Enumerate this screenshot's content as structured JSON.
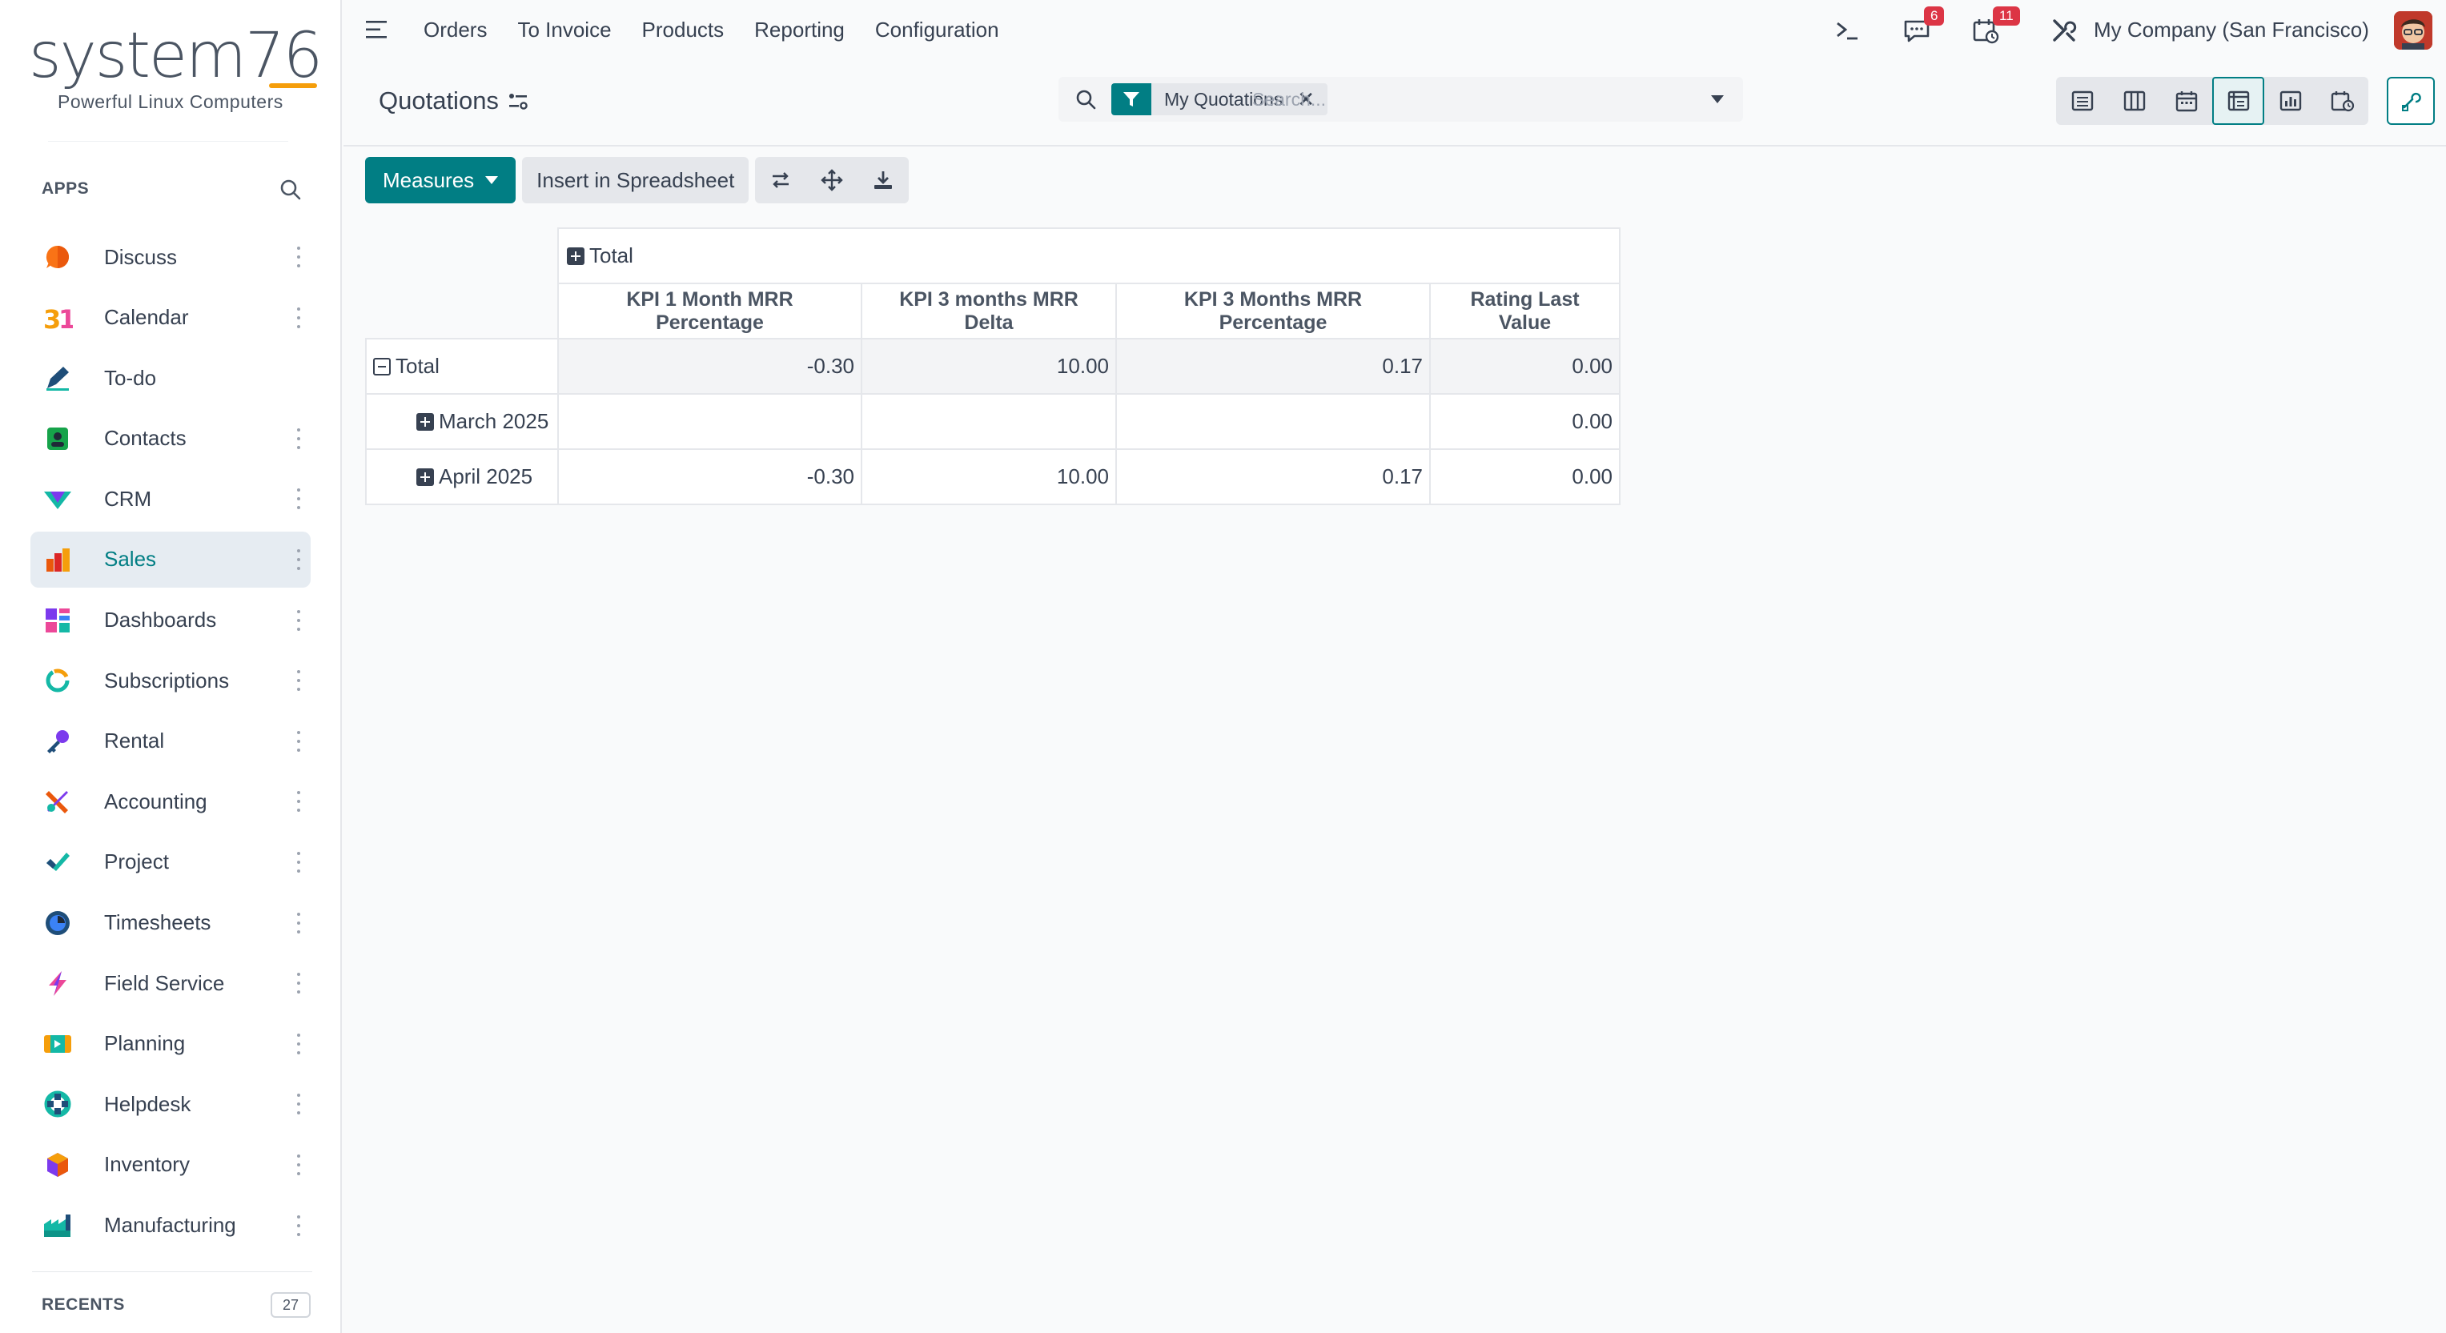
{
  "brand": {
    "logo": "system76",
    "tagline": "Powerful Linux Computers"
  },
  "sidebar": {
    "apps_heading": "APPS",
    "items": [
      {
        "label": "Discuss",
        "icon": "discuss-icon",
        "active": false
      },
      {
        "label": "Calendar",
        "icon": "calendar-app-icon",
        "active": false
      },
      {
        "label": "To-do",
        "icon": "todo-icon",
        "active": false
      },
      {
        "label": "Contacts",
        "icon": "contacts-icon",
        "active": false
      },
      {
        "label": "CRM",
        "icon": "crm-icon",
        "active": false
      },
      {
        "label": "Sales",
        "icon": "sales-icon",
        "active": true
      },
      {
        "label": "Dashboards",
        "icon": "dashboards-icon",
        "active": false
      },
      {
        "label": "Subscriptions",
        "icon": "subscriptions-icon",
        "active": false
      },
      {
        "label": "Rental",
        "icon": "rental-icon",
        "active": false
      },
      {
        "label": "Accounting",
        "icon": "accounting-icon",
        "active": false
      },
      {
        "label": "Project",
        "icon": "project-icon",
        "active": false
      },
      {
        "label": "Timesheets",
        "icon": "timesheets-icon",
        "active": false
      },
      {
        "label": "Field Service",
        "icon": "field-service-icon",
        "active": false
      },
      {
        "label": "Planning",
        "icon": "planning-icon",
        "active": false
      },
      {
        "label": "Helpdesk",
        "icon": "helpdesk-icon",
        "active": false
      },
      {
        "label": "Inventory",
        "icon": "inventory-icon",
        "active": false
      },
      {
        "label": "Manufacturing",
        "icon": "manufacturing-icon",
        "active": false
      }
    ],
    "recents_heading": "RECENTS",
    "recents_count": "27"
  },
  "topnav": {
    "menu": [
      "Orders",
      "To Invoice",
      "Products",
      "Reporting",
      "Configuration"
    ],
    "messages_badge": "6",
    "activities_badge": "11",
    "company": "My Company (San Francisco)"
  },
  "control": {
    "breadcrumb": "Quotations",
    "facet_label": "My Quotations",
    "search_placeholder": "Search..."
  },
  "toolbar": {
    "measures_label": "Measures",
    "insert_label": "Insert in Spreadsheet"
  },
  "pivot": {
    "col_header": "Total",
    "measures": [
      "KPI 1 Month MRR Percentage",
      "KPI 3 months MRR Delta",
      "KPI 3 Months MRR Percentage",
      "Rating Last Value"
    ],
    "rows": [
      {
        "label": "Total",
        "values": [
          "-0.30",
          "10.00",
          "0.17",
          "0.00"
        ]
      },
      {
        "label": "March 2025",
        "values": [
          "",
          "",
          "",
          "0.00"
        ]
      },
      {
        "label": "April 2025",
        "values": [
          "-0.30",
          "10.00",
          "0.17",
          "0.00"
        ]
      }
    ]
  },
  "colors": {
    "accent": "#017e84",
    "badge": "#dc3545",
    "brand_orange": "#f59e0b"
  }
}
